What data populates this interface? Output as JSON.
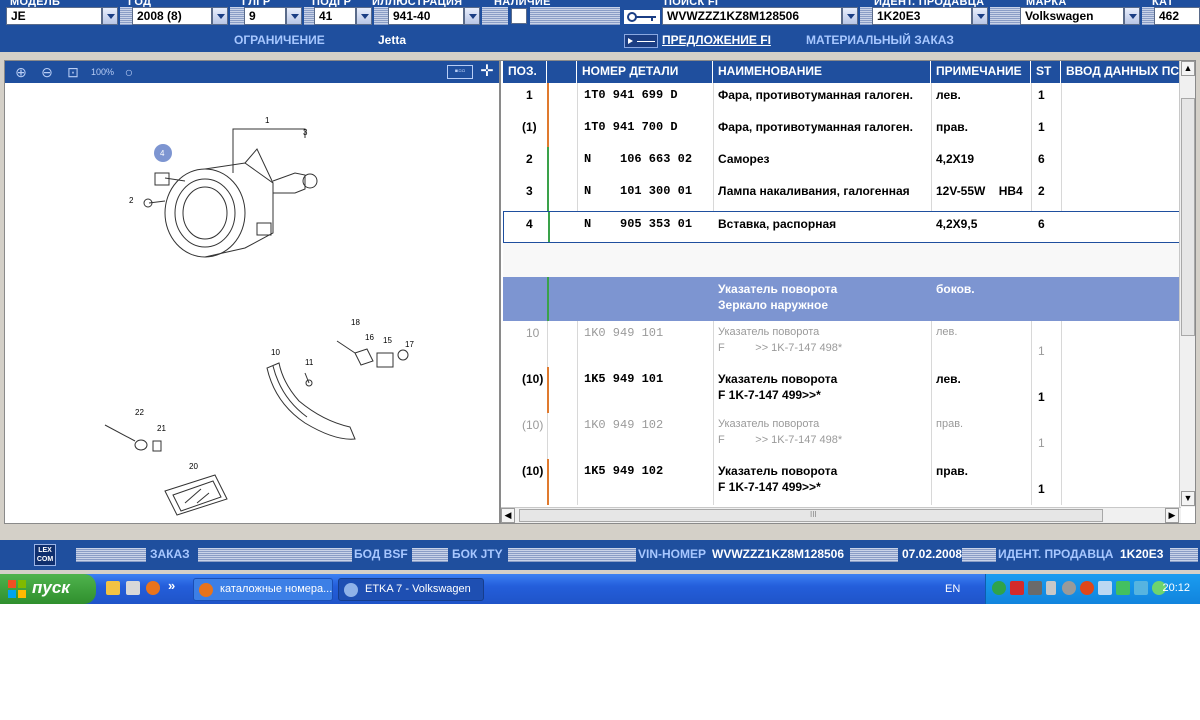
{
  "header": {
    "labels": [
      "МОДЕЛЬ",
      "ГОД",
      "ГЛГР",
      "ПОДГР",
      "ИЛЛЮСТРАЦИЯ",
      "НАЛИЧИЕ",
      "ПОИСК FI",
      "ИДЕНТ. ПРОДАВЦА",
      "МАРКА",
      "КАТ"
    ],
    "model": "JE",
    "year": "2008 (8)",
    "main_group": "9",
    "sub_group": "41",
    "illustration": "941-40",
    "search_fi": "WVWZZZ1KZ8M128506",
    "dealer_id": "1K20E3",
    "brand": "Volkswagen",
    "catalog": "462",
    "restriction_label": "ОГРАНИЧЕНИЕ",
    "model_name": "Jetta",
    "fi_offer_label": "ПРЕДЛОЖЕНИЕ FI",
    "material_order_label": "МАТЕРИАЛЬНЫЙ ЗАКАЗ"
  },
  "illustration_toolbar": {
    "icons": [
      "zoom-in-icon",
      "zoom-out-icon",
      "zoom-area-icon",
      "zoom-100-icon",
      "search-icon"
    ]
  },
  "illustration_callouts": [
    "1",
    "3",
    "4",
    "2",
    "18",
    "16",
    "15",
    "17",
    "10",
    "11",
    "22",
    "21",
    "20"
  ],
  "table": {
    "columns": [
      "ПОЗ.",
      "",
      "НОМЕР ДЕТАЛИ",
      "НАИМЕНОВАНИЕ",
      "ПРИМЕЧАНИЕ",
      "ST",
      "ВВОД ДАННЫХ ПС"
    ],
    "rows": [
      {
        "pos": "1",
        "part": "1T0 941 699 D",
        "name": "Фара, противотуманная галоген.",
        "note": "лев.",
        "st": "1"
      },
      {
        "pos": "(1)",
        "part": "1T0 941 700 D",
        "name": "Фара, противотуманная галоген.",
        "note": "прав.",
        "st": "1"
      },
      {
        "pos": "2",
        "part": "N    106 663 02",
        "name": "Саморез",
        "note": "4,2X19",
        "st": "6"
      },
      {
        "pos": "3",
        "part": "N    101 300 01",
        "name": "Лампа накаливания, галогенная",
        "note": "12V-55W    HB4",
        "st": "2"
      },
      {
        "pos": "4",
        "part": "N    905 353 01",
        "name": "Вставка, распорная",
        "note": "4,2X9,5",
        "st": "6"
      }
    ],
    "group_header": {
      "name1": "Указатель поворота",
      "name2": "Зеркало наружное",
      "note": "боков."
    },
    "rows2": [
      {
        "pos": "10",
        "part": "1K0 949 101",
        "name1": "Указатель поворота",
        "name2": "F          >> 1K-7-147 498*",
        "note": "лев.",
        "st": "1"
      },
      {
        "pos": "(10)",
        "part": "1K5 949 101",
        "name1": "Указатель поворота",
        "name2": "F 1K-7-147 499>>*",
        "note": "лев.",
        "st": "1"
      },
      {
        "pos": "(10)",
        "part": "1K0 949 102",
        "name1": "Указатель поворота",
        "name2": "F          >> 1K-7-147 498*",
        "note": "прав.",
        "st": "1"
      },
      {
        "pos": "(10)",
        "part": "1K5 949 102",
        "name1": "Указатель поворота",
        "name2": "F 1K-7-147 499>>*",
        "note": "прав.",
        "st": "1"
      }
    ],
    "hscroll_mark": "III"
  },
  "statusbar": {
    "logo": "LEX COM",
    "order": "ЗАКАЗ",
    "bod": "БОД BSF",
    "bok": "БОК JTY",
    "vin_label": "VIN-НОМЕР",
    "vin": "WVWZZZ1KZ8M128506",
    "date": "07.02.2008",
    "dealer_label": "ИДЕНТ. ПРОДАВЦА",
    "dealer": "1K20E3"
  },
  "taskbar": {
    "start": "пуск",
    "chevron": "»",
    "task1": "каталожные номера...",
    "task2": "ETKA 7 - Volkswagen",
    "lang": "EN",
    "clock": "20:12"
  },
  "colors": {
    "header_blue": "#1f4f9e",
    "link_blue": "#a7c7ff",
    "marker_orange": "#e07a2e",
    "marker_green": "#3aa24a",
    "group_bg": "#7d95d1"
  }
}
